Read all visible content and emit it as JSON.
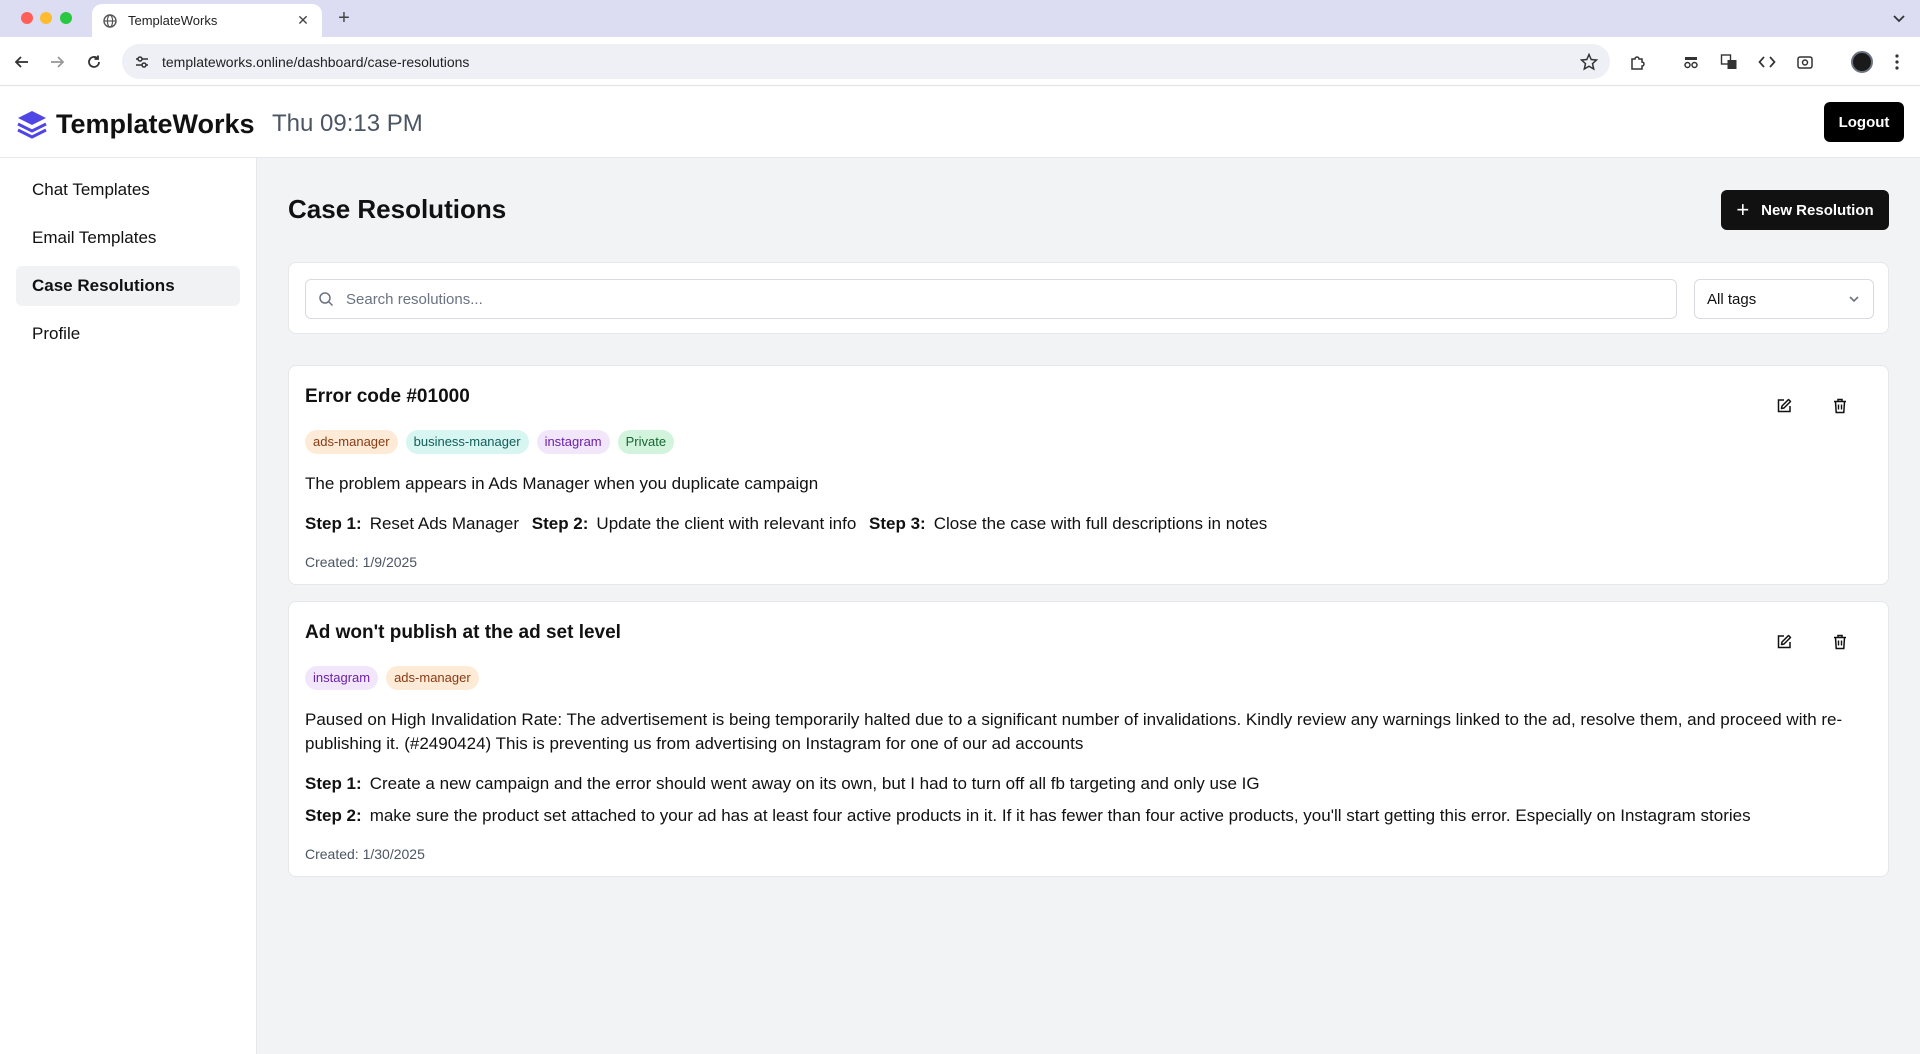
{
  "browser": {
    "tab_title": "TemplateWorks",
    "url": "templateworks.online/dashboard/case-resolutions"
  },
  "header": {
    "brand": "TemplateWorks",
    "clock": "Thu 09:13 PM",
    "logout_label": "Logout"
  },
  "sidebar": {
    "items": [
      {
        "label": "Chat Templates"
      },
      {
        "label": "Email Templates"
      },
      {
        "label": "Case Resolutions"
      },
      {
        "label": "Profile"
      }
    ]
  },
  "main": {
    "title": "Case Resolutions",
    "new_button_label": "New Resolution",
    "search_placeholder": "Search resolutions...",
    "tag_filter": "All tags",
    "cards": [
      {
        "title": "Error code #01000",
        "tags": [
          "ads-manager",
          "business-manager",
          "instagram",
          "Private"
        ],
        "description": "The problem appears in Ads Manager when you duplicate campaign",
        "steps": [
          {
            "label": "Step 1:",
            "text": "Reset Ads Manager"
          },
          {
            "label": "Step 2:",
            "text": "Update the client with relevant info"
          },
          {
            "label": "Step 3:",
            "text": "Close the case with full descriptions in notes"
          }
        ],
        "created": "Created: 1/9/2025"
      },
      {
        "title": "Ad won't publish at the ad set level",
        "tags": [
          "instagram",
          "ads-manager"
        ],
        "description": "Paused on High Invalidation Rate: The advertisement is being temporarily halted due to a significant number of invalidations. Kindly review any warnings linked to the ad, resolve them, and proceed with re-publishing it. (#2490424) This is preventing us from advertising on Instagram for one of our ad accounts",
        "steps": [
          {
            "label": "Step 1:",
            "text": "Create a new campaign and the error should went away on its own, but I had to turn off all fb targeting and only use IG"
          },
          {
            "label": "Step 2:",
            "text": "make sure the product set attached to your ad has at least four active products in it. If it has fewer than four active products, you'll start getting this error. Especially on Instagram stories"
          }
        ],
        "created": "Created: 1/30/2025"
      }
    ]
  },
  "colors": {
    "accent": "#4f46e5",
    "primary_button": "#111111",
    "tag_ads_manager": "#fdebd7",
    "tag_business_manager": "#d7f5f1",
    "tag_instagram": "#f2e6fb",
    "tag_private": "#d3f4dc"
  }
}
